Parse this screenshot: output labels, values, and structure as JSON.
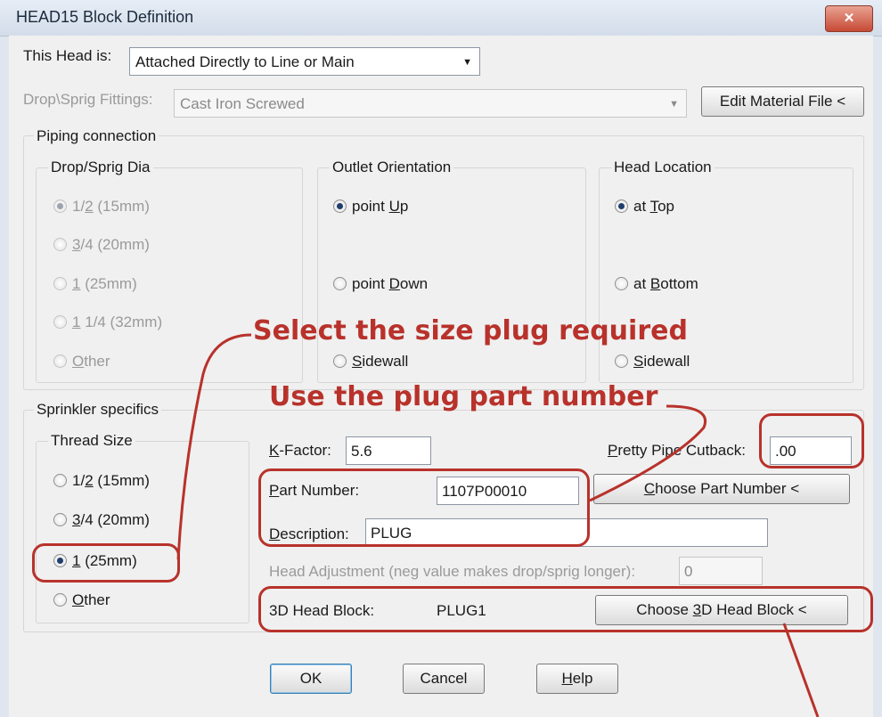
{
  "window": {
    "title": "HEAD15 Block Definition",
    "close_glyph": "✕"
  },
  "head_is": {
    "label": "This Head is:",
    "value": "Attached Directly to Line or Main"
  },
  "drop_fittings": {
    "label": "Drop\\Sprig Fittings:",
    "value": "Cast Iron Screwed"
  },
  "edit_material_button": "Edit Material File <",
  "piping": {
    "group_label": "Piping connection",
    "drop_dia": {
      "label": "Drop/Sprig Dia",
      "options": [
        {
          "pre": "1/",
          "key": "2",
          "post": " (15mm)"
        },
        {
          "pre": "",
          "key": "3",
          "post": "/4 (20mm)"
        },
        {
          "pre": "",
          "key": "1",
          "post": " (25mm)"
        },
        {
          "pre": "",
          "key": "1",
          "post": " 1/4 (32mm)"
        },
        {
          "pre": "",
          "key": "O",
          "post": "ther"
        }
      ]
    },
    "outlet": {
      "label": "Outlet Orientation",
      "options": [
        {
          "pre": "point ",
          "key": "U",
          "post": "p"
        },
        {
          "pre": "point ",
          "key": "D",
          "post": "own"
        },
        {
          "pre": "",
          "key": "S",
          "post": "idewall"
        }
      ]
    },
    "location": {
      "label": "Head Location",
      "options": [
        {
          "pre": "at ",
          "key": "T",
          "post": "op"
        },
        {
          "pre": "at ",
          "key": "B",
          "post": "ottom"
        },
        {
          "pre": "",
          "key": "S",
          "post": "idewall"
        }
      ]
    }
  },
  "sprinkler": {
    "group_label": "Sprinkler specifics",
    "thread_label": "Thread Size",
    "thread_options": [
      {
        "pre": "1/",
        "key": "2",
        "post": " (15mm)"
      },
      {
        "pre": "",
        "key": "3",
        "post": "/4 (20mm)"
      },
      {
        "pre": "",
        "key": "1",
        "post": " (25mm)"
      },
      {
        "pre": "",
        "key": "O",
        "post": "ther"
      }
    ]
  },
  "kfactor": {
    "pre": "",
    "key": "K",
    "post": "-Factor:",
    "value": "5.6"
  },
  "cutback": {
    "pre": "",
    "key": "P",
    "post": "retty Pipe Cutback:",
    "value": ".00"
  },
  "part_number": {
    "pre": "",
    "key": "P",
    "post": "art Number:",
    "value": "1107P00010"
  },
  "choose_part_button": {
    "pre": "",
    "key": "C",
    "post": "hoose Part Number <"
  },
  "description": {
    "pre": "",
    "key": "D",
    "post": "escription:",
    "value": "PLUG"
  },
  "head_adjustment": {
    "label": "Head Adjustment (neg value makes drop/sprig longer):",
    "value": "0"
  },
  "head_block": {
    "label": "3D Head Block:",
    "value": "PLUG1"
  },
  "choose_3d_button": {
    "pre": "Choose ",
    "key": "3",
    "post": "D Head Block <"
  },
  "buttons": {
    "ok": "OK",
    "cancel": "Cancel",
    "help_pre": "",
    "help_key": "H",
    "help_post": "elp"
  },
  "annotations": {
    "select_size": "Select the size plug required",
    "use_part": "Use the plug part number"
  },
  "colors": {
    "annotation": "#b8322b",
    "selected_radio": "#1e3f6e"
  }
}
